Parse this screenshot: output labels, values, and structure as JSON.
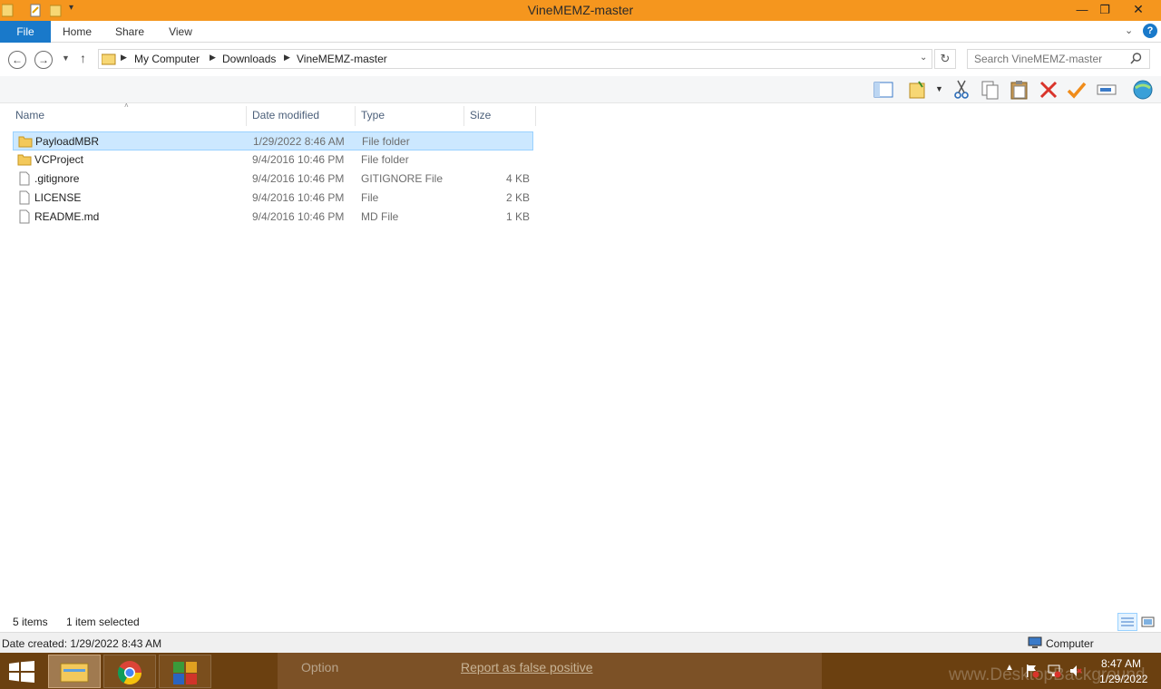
{
  "window": {
    "title": "VineMEMZ-master",
    "controls": [
      "minimize",
      "maximize",
      "close"
    ],
    "accent_color": "#f5961e"
  },
  "ribbon": {
    "tabs": [
      {
        "label": "File"
      },
      {
        "label": "Home"
      },
      {
        "label": "Share"
      },
      {
        "label": "View"
      }
    ]
  },
  "address": {
    "breadcrumbs": [
      "My Computer",
      "Downloads",
      "VineMEMZ-master"
    ]
  },
  "search": {
    "placeholder": "Search VineMEMZ-master"
  },
  "columns": {
    "name": "Name",
    "date": "Date modified",
    "type": "Type",
    "size": "Size"
  },
  "files": [
    {
      "name": "PayloadMBR",
      "date": "1/29/2022 8:46 AM",
      "type": "File folder",
      "size": "",
      "icon": "folder-icon",
      "selected": true
    },
    {
      "name": "VCProject",
      "date": "9/4/2016 10:46 PM",
      "type": "File folder",
      "size": "",
      "icon": "folder-icon",
      "selected": false
    },
    {
      "name": ".gitignore",
      "date": "9/4/2016 10:46 PM",
      "type": "GITIGNORE File",
      "size": "4 KB",
      "icon": "file-icon",
      "selected": false
    },
    {
      "name": "LICENSE",
      "date": "9/4/2016 10:46 PM",
      "type": "File",
      "size": "2 KB",
      "icon": "file-icon",
      "selected": false
    },
    {
      "name": "README.md",
      "date": "9/4/2016 10:46 PM",
      "type": "MD File",
      "size": "1 KB",
      "icon": "file-icon",
      "selected": false
    }
  ],
  "status": {
    "item_count": "5 items",
    "selection": "1 item selected"
  },
  "details": {
    "date_created": "Date created: 1/29/2022 8:43 AM",
    "location": "Computer"
  },
  "taskbar": {
    "option_label": "Option",
    "report_label": "Report as false positive",
    "time": "8:47 AM",
    "date": "1/29/2022",
    "watermark": "www.DesktopBackground"
  }
}
